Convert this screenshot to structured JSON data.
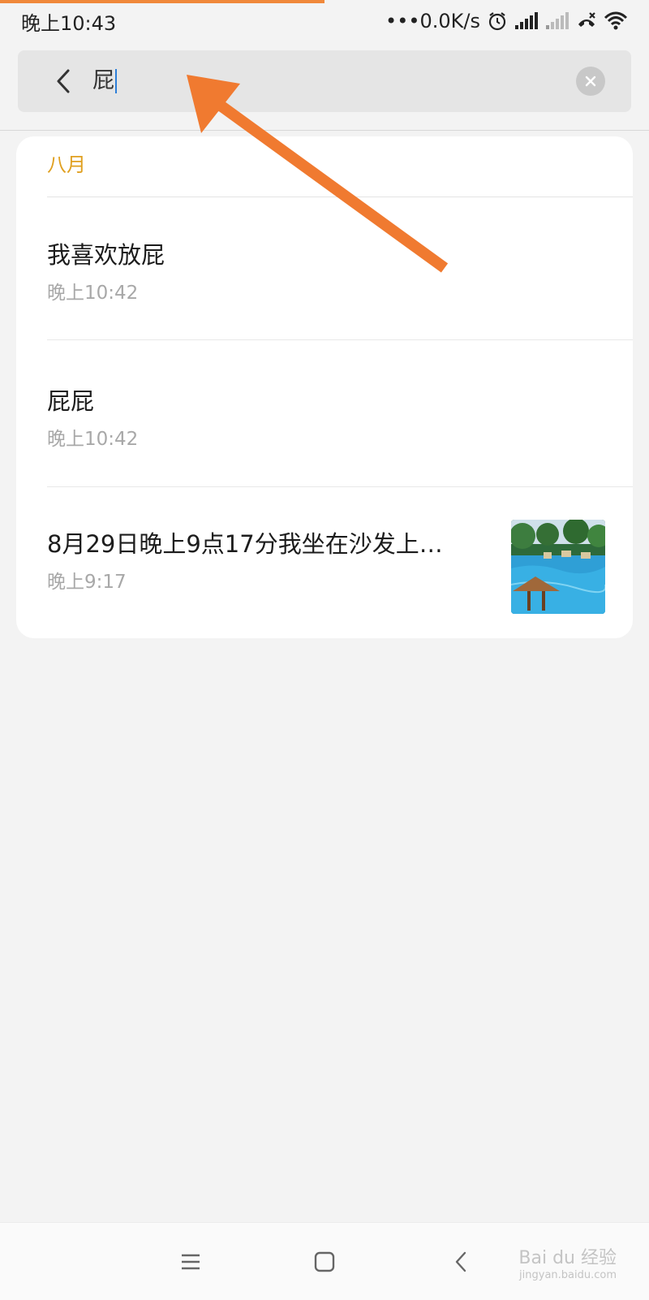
{
  "status_bar": {
    "time": "晚上10:43",
    "network_speed": "•••0.0K/s",
    "icons": [
      "alarm-icon",
      "signal-icon",
      "signal-weak-icon",
      "missed-call-icon",
      "wifi-icon"
    ]
  },
  "search": {
    "query": "屁",
    "back_icon": "chevron-left-icon",
    "clear_icon": "clear-icon"
  },
  "results": {
    "group_label": "八月",
    "items": [
      {
        "title": "我喜欢放屁",
        "time": "晚上10:42"
      },
      {
        "title": "屁屁",
        "time": "晚上10:42"
      },
      {
        "title": "8月29日晚上9点17分我坐在沙发上…",
        "time": "晚上9:17",
        "thumbnail": "pool-photo"
      }
    ]
  },
  "nav": {
    "icons": [
      "menu-icon",
      "home-icon",
      "back-icon"
    ]
  },
  "watermark": {
    "brand": "Bai du 经验",
    "url": "jingyan.baidu.com"
  },
  "colors": {
    "accent": "#e0a020",
    "arrow": "#f07a30",
    "caret": "#2d7fd8"
  }
}
